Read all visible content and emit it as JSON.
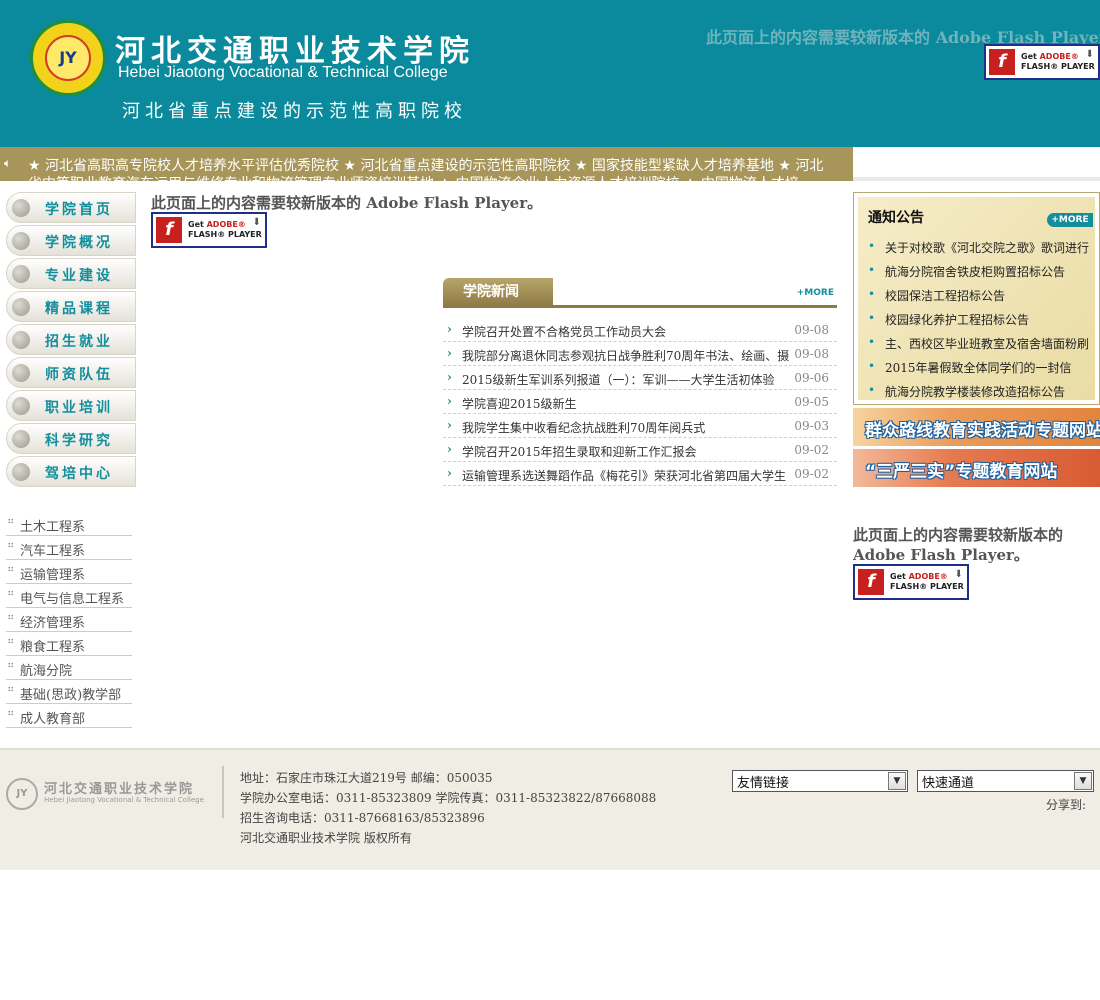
{
  "header": {
    "logo_emblem": "JY",
    "logo_cn": "河北交通职业技术学院",
    "logo_en": "Hebei Jiaotong Vocational & Technical College",
    "slogan": "河北省重点建设的示范性高职院校",
    "flash_notice": "此页面上的内容需要较新版本的 Adobe Flash Player。"
  },
  "flash_badge": {
    "line1_prefix": "Get ",
    "line1_brand": "ADOBE®",
    "line2": "FLASH® PLAYER"
  },
  "ticker": {
    "text": "★ 河北省高职高专院校人才培养水平评估优秀院校 ★ 河北省重点建设的示范性高职院校 ★ 国家技能型紧缺人才培养基地 ★ 河北省中等职业教育汽车运用与维修专业和物流管理专业师资培训基地 ★ 中国物流企业人力资源人才培训院校 ★ 中国物流人才培"
  },
  "nav": {
    "items": [
      "学院首页",
      "学院概况",
      "专业建设",
      "精品课程",
      "招生就业",
      "师资队伍",
      "职业培训",
      "科学研究",
      "驾培中心"
    ]
  },
  "departments": {
    "items": [
      "土木工程系",
      "汽车工程系",
      "运输管理系",
      "电气与信息工程系",
      "经济管理系",
      "粮食工程系",
      "航海分院",
      "基础(思政)教学部",
      "成人教育部"
    ]
  },
  "main": {
    "flash_notice": "此页面上的内容需要较新版本的  Adobe Flash Player。"
  },
  "news": {
    "title": "学院新闻",
    "more": "+MORE",
    "items": [
      {
        "title": "学院召开处置不合格党员工作动员大会",
        "date": "09-08"
      },
      {
        "title": "我院部分离退休同志参观抗日战争胜利70周年书法、绘画、摄",
        "date": "09-08"
      },
      {
        "title": "2015级新生军训系列报道（一）：军训——大学生活初体验",
        "date": "09-06"
      },
      {
        "title": "学院喜迎2015级新生",
        "date": "09-05"
      },
      {
        "title": "我院学生集中收看纪念抗战胜利70周年阅兵式",
        "date": "09-03"
      },
      {
        "title": "学院召开2015年招生录取和迎新工作汇报会",
        "date": "09-02"
      },
      {
        "title": "运输管理系选送舞蹈作品《梅花引》荣获河北省第四届大学生",
        "date": "09-02"
      }
    ]
  },
  "notice": {
    "title": "通知公告",
    "more": "+MORE",
    "items": [
      "关于对校歌《河北交院之歌》歌词进行",
      "航海分院宿舍铁皮柜购置招标公告",
      "校园保洁工程招标公告",
      "校园绿化养护工程招标公告",
      "主、西校区毕业班教室及宿舍墙面粉刷",
      "2015年暑假致全体同学们的一封信",
      "航海分院教学楼装修改造招标公告"
    ]
  },
  "banners": {
    "banner1": "群众路线教育实践活动专题网站",
    "banner2": "“三严三实”专题教育网站"
  },
  "right": {
    "flash_notice": "此页面上的内容需要较新版本的 Adobe Flash Player。"
  },
  "footer": {
    "logo_cn": "河北交通职业技术学院",
    "logo_en": "Hebei Jiaotong Vocational & Technical College",
    "address": "地址：石家庄市珠江大道219号  邮编：050035",
    "phone": "学院办公室电话：0311-85323809 学院传真：0311-85323822/87668088",
    "admission": "招生咨询电话：0311-87668163/85323896",
    "copyright": "河北交通职业技术学院  版权所有",
    "links_select": "友情链接",
    "quick_select": "快速通道",
    "share": "分享到:"
  }
}
